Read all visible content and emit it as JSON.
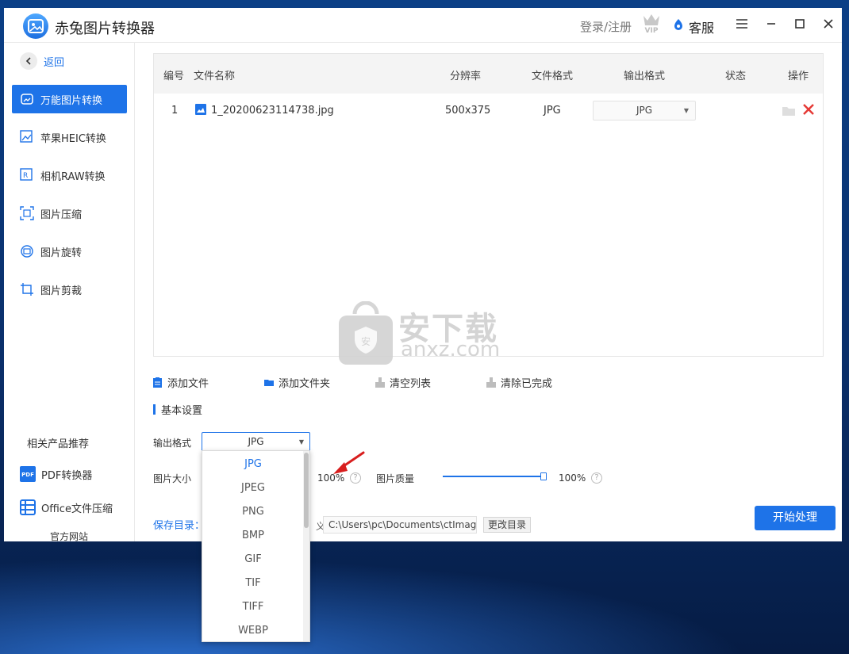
{
  "app": {
    "title": "赤兔图片转换器",
    "login": "登录/注册",
    "service": "客服"
  },
  "sidebar": {
    "back": "返回",
    "items": [
      {
        "label": "万能图片转换",
        "active": true
      },
      {
        "label": "苹果HEIC转换"
      },
      {
        "label": "相机RAW转换"
      },
      {
        "label": "图片压缩"
      },
      {
        "label": "图片旋转"
      },
      {
        "label": "图片剪裁"
      }
    ],
    "related": "相关产品推荐",
    "products": [
      {
        "label": "PDF转换器",
        "icon": "pdf-icon"
      },
      {
        "label": "Office文件压缩",
        "icon": "office-icon"
      }
    ],
    "official": "官方网站"
  },
  "table": {
    "headers": {
      "no": "编号",
      "name": "文件名称",
      "resolution": "分辨率",
      "format": "文件格式",
      "output": "输出格式",
      "status": "状态",
      "action": "操作"
    },
    "rows": [
      {
        "no": "1",
        "name": "1_20200623114738.jpg",
        "resolution": "500x375",
        "format": "JPG",
        "output": "JPG",
        "status": ""
      }
    ]
  },
  "watermark": {
    "text": "安下载",
    "sub": "anxz.com"
  },
  "actions": {
    "add_file": "添加文件",
    "add_folder": "添加文件夹",
    "clear_list": "清空列表",
    "clear_done": "清除已完成"
  },
  "settings": {
    "title": "基本设置",
    "output_format_label": "输出格式",
    "output_format_value": "JPG",
    "size_label": "图片大小",
    "size_value": "100%",
    "quality_label": "图片质量",
    "quality_value": "100%",
    "quality_level": 1.0,
    "save_dir_label": "保存目录：",
    "path_prefix": "义",
    "save_path": "C:\\Users\\pc\\Documents\\ctImag",
    "change_dir": "更改目录",
    "start": "开始处理"
  },
  "dropdown": {
    "options": [
      "JPG",
      "JPEG",
      "PNG",
      "BMP",
      "GIF",
      "TIF",
      "TIFF",
      "WEBP"
    ],
    "selected": "JPG"
  },
  "colors": {
    "accent": "#1e73e8",
    "delete": "#e53935"
  }
}
